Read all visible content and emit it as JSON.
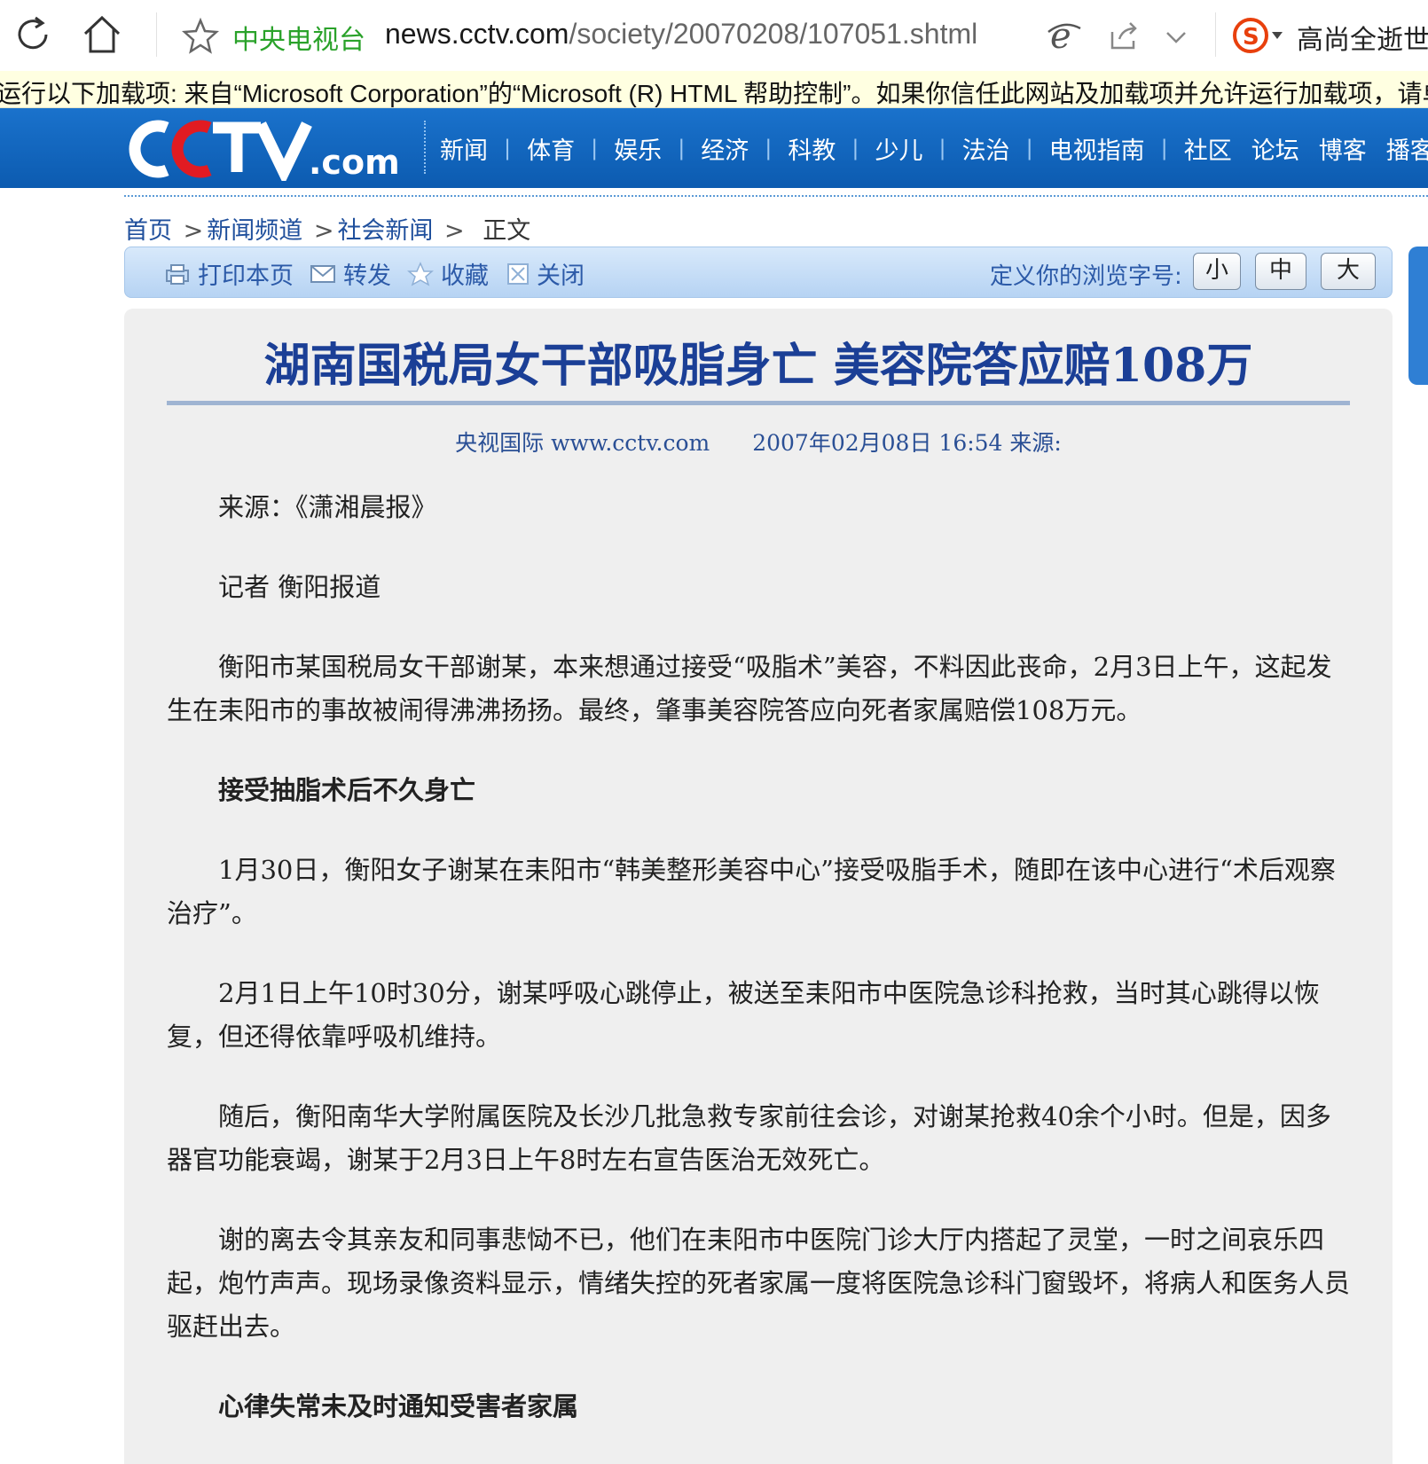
{
  "browser": {
    "site_name": "中央电视台",
    "url_host": "news.cctv.com",
    "url_path": "/society/20070208/107051.shtml",
    "search_hint": "高尚全逝世"
  },
  "infobar": {
    "message": "运行以下加载项: 来自“Microsoft Corporation”的“Microsoft (R) HTML 帮助控制”。如果你信任此网站及加载项并允许运行加载项，请单"
  },
  "header": {
    "nav": [
      "新闻",
      "体育",
      "娱乐",
      "经济",
      "科教",
      "少儿",
      "法治",
      "电视指南"
    ],
    "nav_plain": [
      "社区",
      "论坛",
      "博客",
      "播客"
    ],
    "colors": {
      "header_blue": "#0c5bb0",
      "headline_blue": "#1b3f96",
      "logo_red": "#e11b22"
    }
  },
  "breadcrumb": {
    "items": [
      "首页",
      "新闻频道",
      "社会新闻"
    ],
    "separator": ">",
    "current": "正文"
  },
  "toolbar": {
    "print": "打印本页",
    "forward": "转发",
    "favorite": "收藏",
    "close": "关闭",
    "fontsize_label": "定义你的浏览字号:",
    "small": "小",
    "medium": "中",
    "large": "大"
  },
  "article": {
    "title": "湖南国税局女干部吸脂身亡  美容院答应赔108万",
    "meta_source": "央视国际 www.cctv.com",
    "meta_time": "2007年02月08日 16:54 来源:",
    "paragraphs": [
      {
        "text": "来源：《潇湘晨报》",
        "sub": false
      },
      {
        "text": "记者 衡阳报道",
        "sub": false
      },
      {
        "text": "衡阳市某国税局女干部谢某，本来想通过接受“吸脂术”美容，不料因此丧命，2月3日上午，这起发生在耒阳市的事故被闹得沸沸扬扬。最终，肇事美容院答应向死者家属赔偿108万元。",
        "sub": false
      },
      {
        "text": "接受抽脂术后不久身亡",
        "sub": true
      },
      {
        "text": "1月30日，衡阳女子谢某在耒阳市“韩美整形美容中心”接受吸脂手术，随即在该中心进行“术后观察治疗”。",
        "sub": false
      },
      {
        "text": "2月1日上午10时30分，谢某呼吸心跳停止，被送至耒阳市中医院急诊科抢救，当时其心跳得以恢复，但还得依靠呼吸机维持。",
        "sub": false
      },
      {
        "text": "随后，衡阳南华大学附属医院及长沙几批急救专家前往会诊，对谢某抢救40余个小时。但是，因多器官功能衰竭，谢某于2月3日上午8时左右宣告医治无效死亡。",
        "sub": false
      },
      {
        "text": "谢的离去令其亲友和同事悲恸不已，他们在耒阳市中医院门诊大厅内搭起了灵堂，一时之间哀乐四起，炮竹声声。现场录像资料显示，情绪失控的死者家属一度将医院急诊科门窗毁坏，将病人和医务人员驱赶出去。",
        "sub": false
      },
      {
        "text": "心律失常未及时通知受害者家属",
        "sub": true
      }
    ]
  }
}
